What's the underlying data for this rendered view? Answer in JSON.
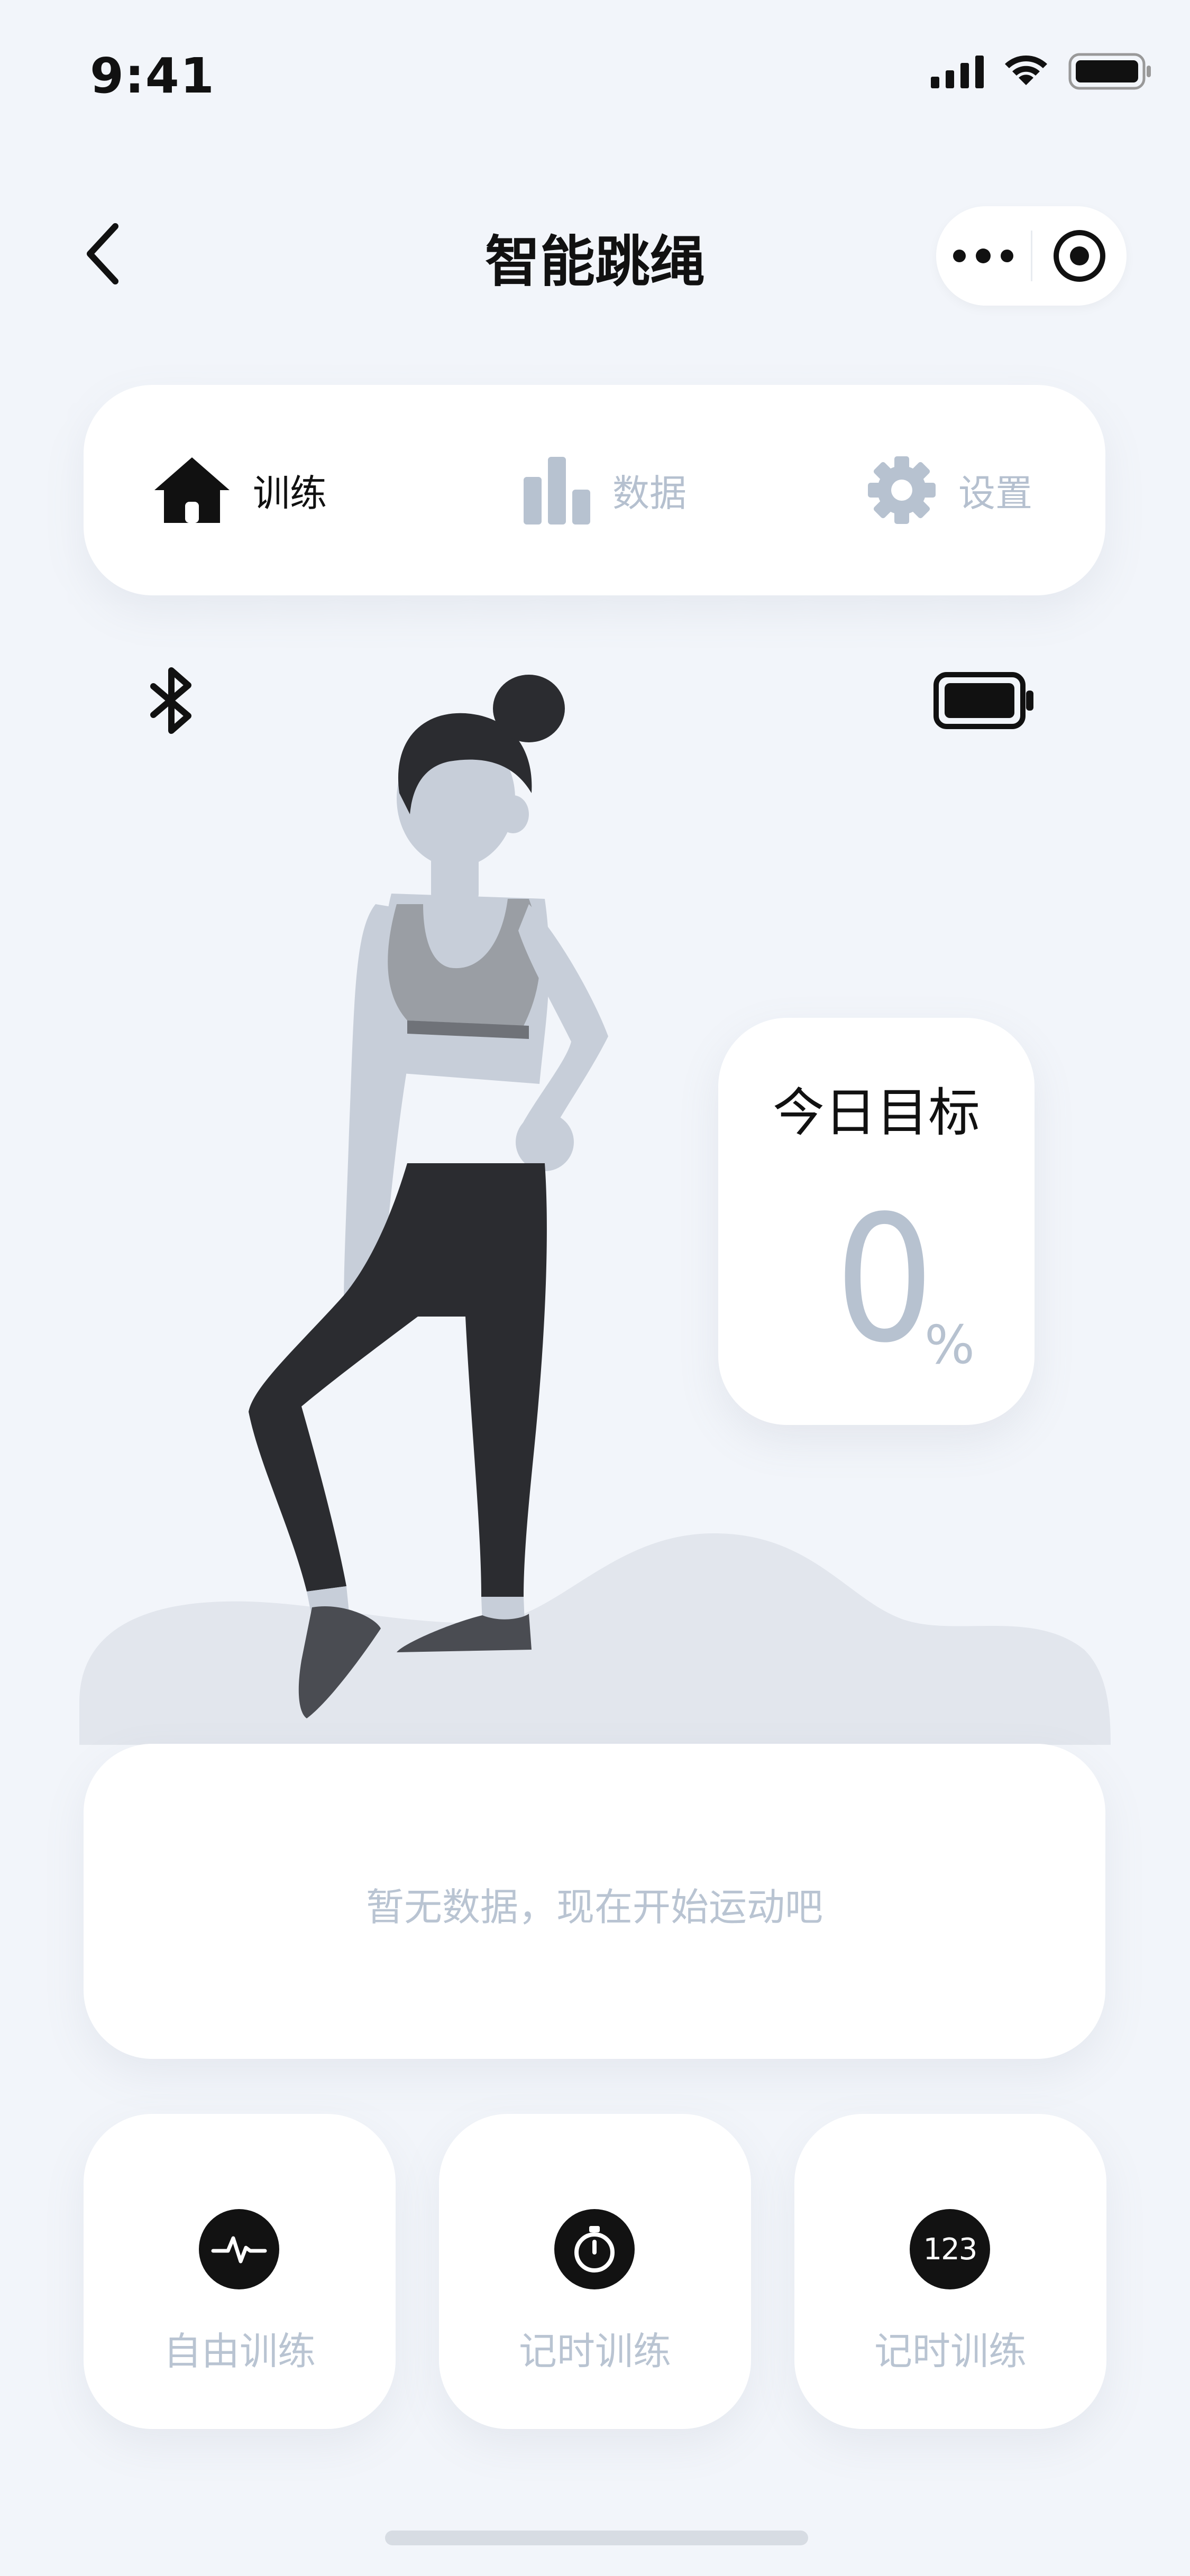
{
  "status_bar": {
    "time": "9:41"
  },
  "nav": {
    "title": "智能跳绳"
  },
  "tabs": [
    {
      "label": "训练",
      "icon": "home-icon",
      "active": true
    },
    {
      "label": "数据",
      "icon": "bar-chart-icon",
      "active": false
    },
    {
      "label": "设置",
      "icon": "gear-icon",
      "active": false
    }
  ],
  "goal": {
    "title": "今日目标",
    "value": "0",
    "unit": "%"
  },
  "empty_state": {
    "text": "暂无数据，现在开始运动吧"
  },
  "modes": [
    {
      "label": "自由训练",
      "icon": "pulse-icon"
    },
    {
      "label": "记时训练",
      "icon": "stopwatch-icon"
    },
    {
      "label": "记时训练",
      "icon": "counter-123-icon",
      "icon_text": "123"
    }
  ],
  "colors": {
    "background": "#f2f5fa",
    "accent_dark": "#121212",
    "muted": "#b9c4d2"
  }
}
